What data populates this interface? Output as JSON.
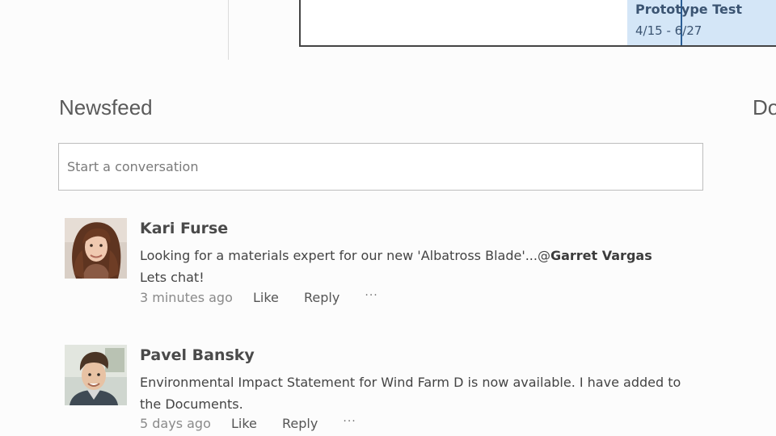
{
  "timeline": {
    "task": {
      "title": "Prototype Test",
      "dates": "4/15 - 6/27"
    }
  },
  "newsfeed": {
    "title": "Newsfeed",
    "compose_placeholder": "Start a conversation",
    "posts": [
      {
        "author": "Kari Furse",
        "text_before": "Looking for a materials expert for our new 'Albatross Blade'...@",
        "mention": "Garret Vargas",
        "text_after_line": "Lets chat!",
        "time": "3 minutes ago",
        "like": "Like",
        "reply": "Reply",
        "more": "···"
      },
      {
        "author": "Pavel Bansky",
        "text": "Environmental Impact Statement for Wind Farm D is now available. I have added to the Documents.",
        "time": "5 days ago",
        "like": "Like",
        "reply": "Reply",
        "more": "···"
      }
    ]
  },
  "documents": {
    "title_fragment": "Do"
  }
}
